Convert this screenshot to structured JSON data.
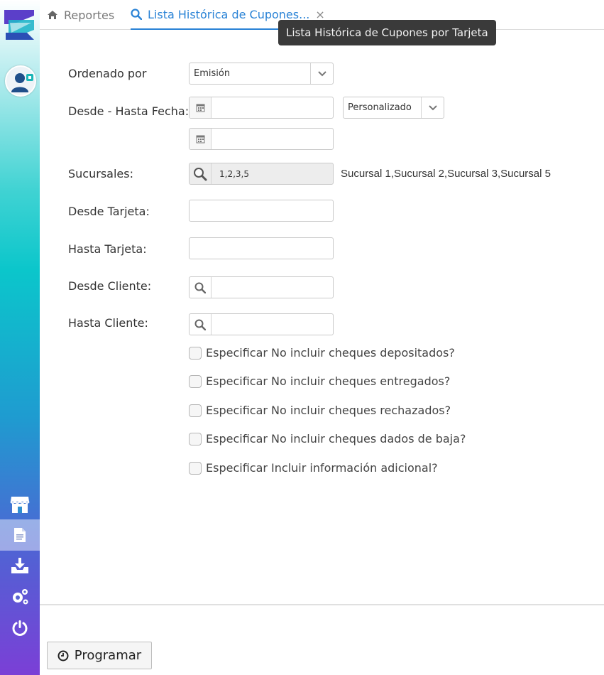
{
  "tabs": {
    "reportes_label": "Reportes",
    "active_label": "Lista Histórica de Cupones...",
    "close_glyph": "×",
    "tooltip": "Lista Histórica de Cupones por Tarjeta"
  },
  "sidebar": {
    "icons": [
      "store-icon",
      "document-icon",
      "download-icon",
      "settings-icon",
      "power-icon"
    ],
    "active": "document-icon"
  },
  "form": {
    "ordenado_label": "Ordenado por",
    "ordenado_value": "Emisión",
    "fecha_label": "Desde - Hasta Fecha:",
    "fecha_range_value": "Personalizado",
    "fecha_desde": "",
    "fecha_hasta": "",
    "sucursales_label": "Sucursales:",
    "sucursales_value": "1,2,3,5",
    "sucursales_names": "Sucursal 1,Sucursal 2,Sucursal 3,Sucursal 5",
    "desde_tarjeta_label": "Desde Tarjeta:",
    "desde_tarjeta_value": "",
    "hasta_tarjeta_label": "Hasta Tarjeta:",
    "hasta_tarjeta_value": "",
    "desde_cliente_label": "Desde Cliente:",
    "desde_cliente_value": "",
    "hasta_cliente_label": "Hasta Cliente:",
    "hasta_cliente_value": ""
  },
  "checkboxes": [
    {
      "label": "Especificar No incluir cheques depositados?",
      "checked": false
    },
    {
      "label": "Especificar No incluir cheques entregados?",
      "checked": false
    },
    {
      "label": "Especificar No incluir cheques rechazados?",
      "checked": false
    },
    {
      "label": "Especificar No incluir cheques dados de baja?",
      "checked": false
    },
    {
      "label": "Especificar Incluir información adicional?",
      "checked": false
    }
  ],
  "footer": {
    "programar_label": "Programar"
  },
  "colors": {
    "accent": "#2a83d6",
    "sidebar_top": "#41d3d3",
    "sidebar_bottom": "#7b3fd6"
  }
}
